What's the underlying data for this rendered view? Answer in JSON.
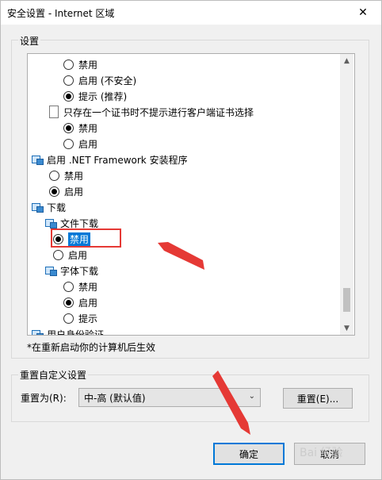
{
  "window": {
    "title": "安全设置 - Internet 区域",
    "close_glyph": "✕"
  },
  "settings_group": {
    "label": "设置",
    "tree": [
      {
        "kind": "radio",
        "label": "禁用",
        "checked": false
      },
      {
        "kind": "radio",
        "label": "启用 (不安全)",
        "checked": false
      },
      {
        "kind": "radio",
        "label": "提示 (推荐)",
        "checked": true
      },
      {
        "kind": "file",
        "label": "只存在一个证书时不提示进行客户端证书选择"
      },
      {
        "kind": "radio",
        "label": "禁用",
        "checked": true
      },
      {
        "kind": "radio",
        "label": "启用",
        "checked": false
      },
      {
        "kind": "category",
        "label": "启用 .NET Framework 安装程序"
      },
      {
        "kind": "radio",
        "label": "禁用",
        "checked": false
      },
      {
        "kind": "radio",
        "label": "启用",
        "checked": true
      },
      {
        "kind": "category",
        "label": "下载"
      },
      {
        "kind": "category",
        "label": "文件下载"
      },
      {
        "kind": "radio",
        "label": "禁用",
        "checked": true,
        "selected": true
      },
      {
        "kind": "radio",
        "label": "启用",
        "checked": false
      },
      {
        "kind": "category",
        "label": "字体下载"
      },
      {
        "kind": "radio",
        "label": "禁用",
        "checked": false
      },
      {
        "kind": "radio",
        "label": "启用",
        "checked": true
      },
      {
        "kind": "radio",
        "label": "提示",
        "checked": false
      },
      {
        "kind": "category",
        "label": "用户身份验证"
      }
    ],
    "scroll_up_glyph": "▲",
    "scroll_down_glyph": "▼"
  },
  "note": "*在重新启动你的计算机后生效",
  "reset_group": {
    "label": "重置自定义设置",
    "reset_to_label": "重置为(R):",
    "select_value": "中-高 (默认值)",
    "select_arrow": "⌄",
    "reset_button": "重置(E)..."
  },
  "buttons": {
    "ok": "确定",
    "cancel": "取消"
  },
  "annotations": {
    "highlight_color": "#e53935"
  },
  "watermark": "Bai 经验"
}
